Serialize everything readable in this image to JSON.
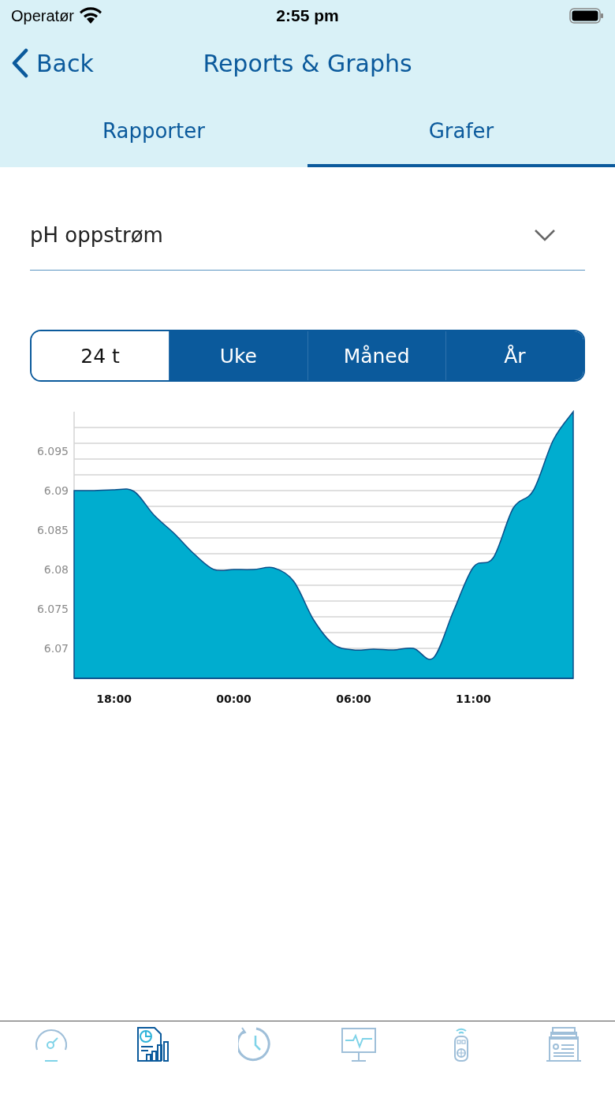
{
  "status_bar": {
    "carrier": "Operatør",
    "time": "2:55 pm"
  },
  "nav": {
    "back": "Back",
    "title": "Reports & Graphs"
  },
  "tabs": [
    {
      "label": "Rapporter",
      "selected": false
    },
    {
      "label": "Grafer",
      "selected": true
    }
  ],
  "dropdown": {
    "value": "pH oppstrøm"
  },
  "periods": [
    {
      "label": "24 t",
      "selected": true
    },
    {
      "label": "Uke",
      "selected": false
    },
    {
      "label": "Måned",
      "selected": false
    },
    {
      "label": "År",
      "selected": false
    }
  ],
  "chart": {
    "chart_data": {
      "type": "area",
      "categories": [
        null,
        null,
        "18:00",
        null,
        null,
        null,
        null,
        null,
        "00:00",
        null,
        null,
        null,
        null,
        null,
        "06:00",
        null,
        null,
        null,
        null,
        null,
        "11:00",
        null,
        null,
        null,
        null,
        null
      ],
      "series": [
        {
          "color": "#00adcf",
          "values": [
            6.09,
            6.09,
            6.0901,
            6.0899,
            6.0869,
            6.0846,
            6.082,
            6.08,
            6.08,
            6.08,
            6.0802,
            6.0785,
            6.0736,
            6.0705,
            6.0698,
            6.0699,
            6.0698,
            6.07,
            6.0688,
            6.0747,
            6.0803,
            6.0815,
            6.0878,
            6.09,
            6.0964,
            6.1
          ]
        }
      ],
      "ylim": [
        6.0662,
        6.1
      ],
      "grid": true,
      "yticks": [
        6.07,
        6.075,
        6.08,
        6.085,
        6.09,
        6.095
      ]
    }
  },
  "bottom_tabs": [
    {
      "kind": "gauge",
      "selected": false
    },
    {
      "kind": "report",
      "selected": true
    },
    {
      "kind": "history",
      "selected": false
    },
    {
      "kind": "monitor",
      "selected": false
    },
    {
      "kind": "remote",
      "selected": false
    },
    {
      "kind": "stack",
      "selected": false
    }
  ]
}
